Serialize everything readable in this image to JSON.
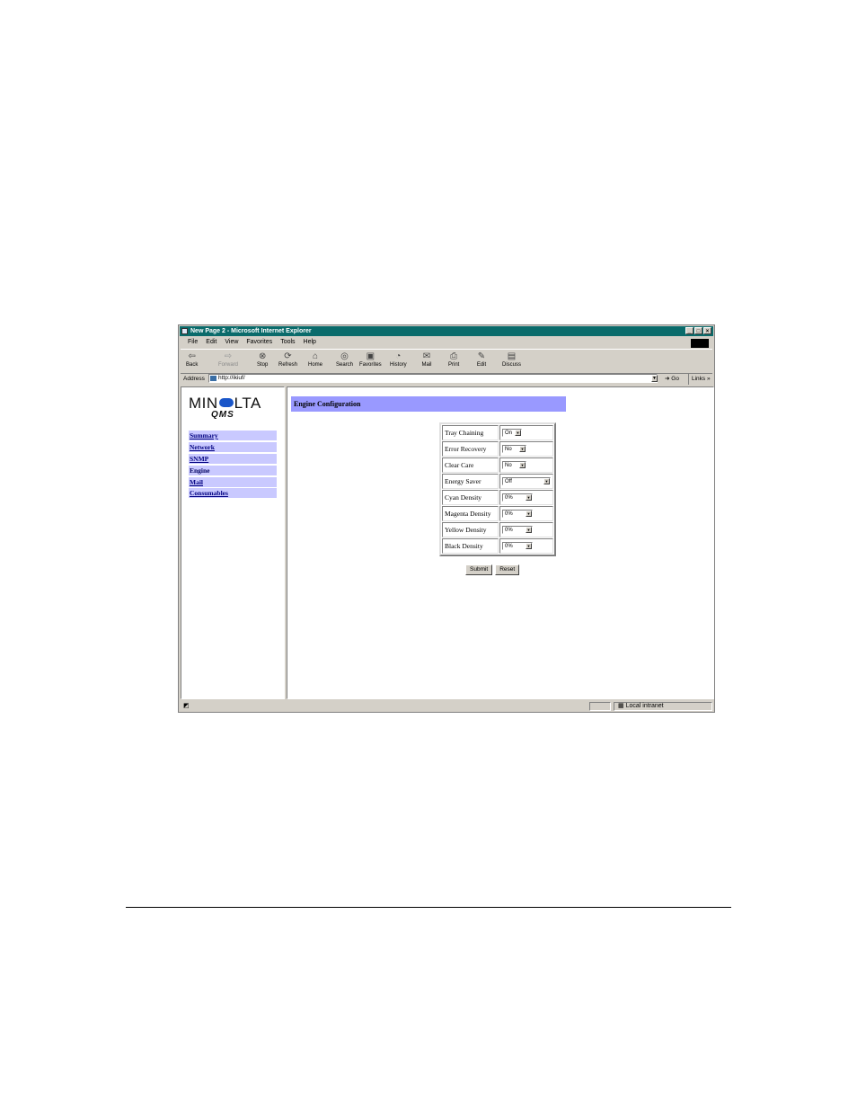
{
  "window": {
    "title": "New Page 2 - Microsoft Internet Explorer"
  },
  "menu": [
    "File",
    "Edit",
    "View",
    "Favorites",
    "Tools",
    "Help"
  ],
  "toolbar": {
    "back": "Back",
    "forward": "Forward",
    "stop": "Stop",
    "refresh": "Refresh",
    "home": "Home",
    "search": "Search",
    "favorites": "Favorites",
    "history": "History",
    "mail": "Mail",
    "print": "Print",
    "edit": "Edit",
    "discuss": "Discuss"
  },
  "address": {
    "label": "Address",
    "url": "http://ikiuf/",
    "go": "Go",
    "links": "Links"
  },
  "logo": {
    "line1a": "MIN",
    "line1b": "LTA",
    "line2": "QMS"
  },
  "nav": [
    "Summary",
    "Network",
    "SNMP",
    "Engine",
    "Mail",
    "Consumables"
  ],
  "page": {
    "header": "Engine Configuration"
  },
  "config": [
    {
      "label": "Tray Chaining",
      "value": "On"
    },
    {
      "label": "Error Recovery",
      "value": "No"
    },
    {
      "label": "Clear Care",
      "value": "No"
    },
    {
      "label": "Energy Saver",
      "value": "Off"
    },
    {
      "label": "Cyan Density",
      "value": "0%"
    },
    {
      "label": "Magenta Density",
      "value": "0%"
    },
    {
      "label": "Yellow Density",
      "value": "0%"
    },
    {
      "label": "Black Density",
      "value": "0%"
    }
  ],
  "buttons": {
    "submit": "Submit",
    "reset": "Reset"
  },
  "status": {
    "zone": "Local intranet"
  }
}
